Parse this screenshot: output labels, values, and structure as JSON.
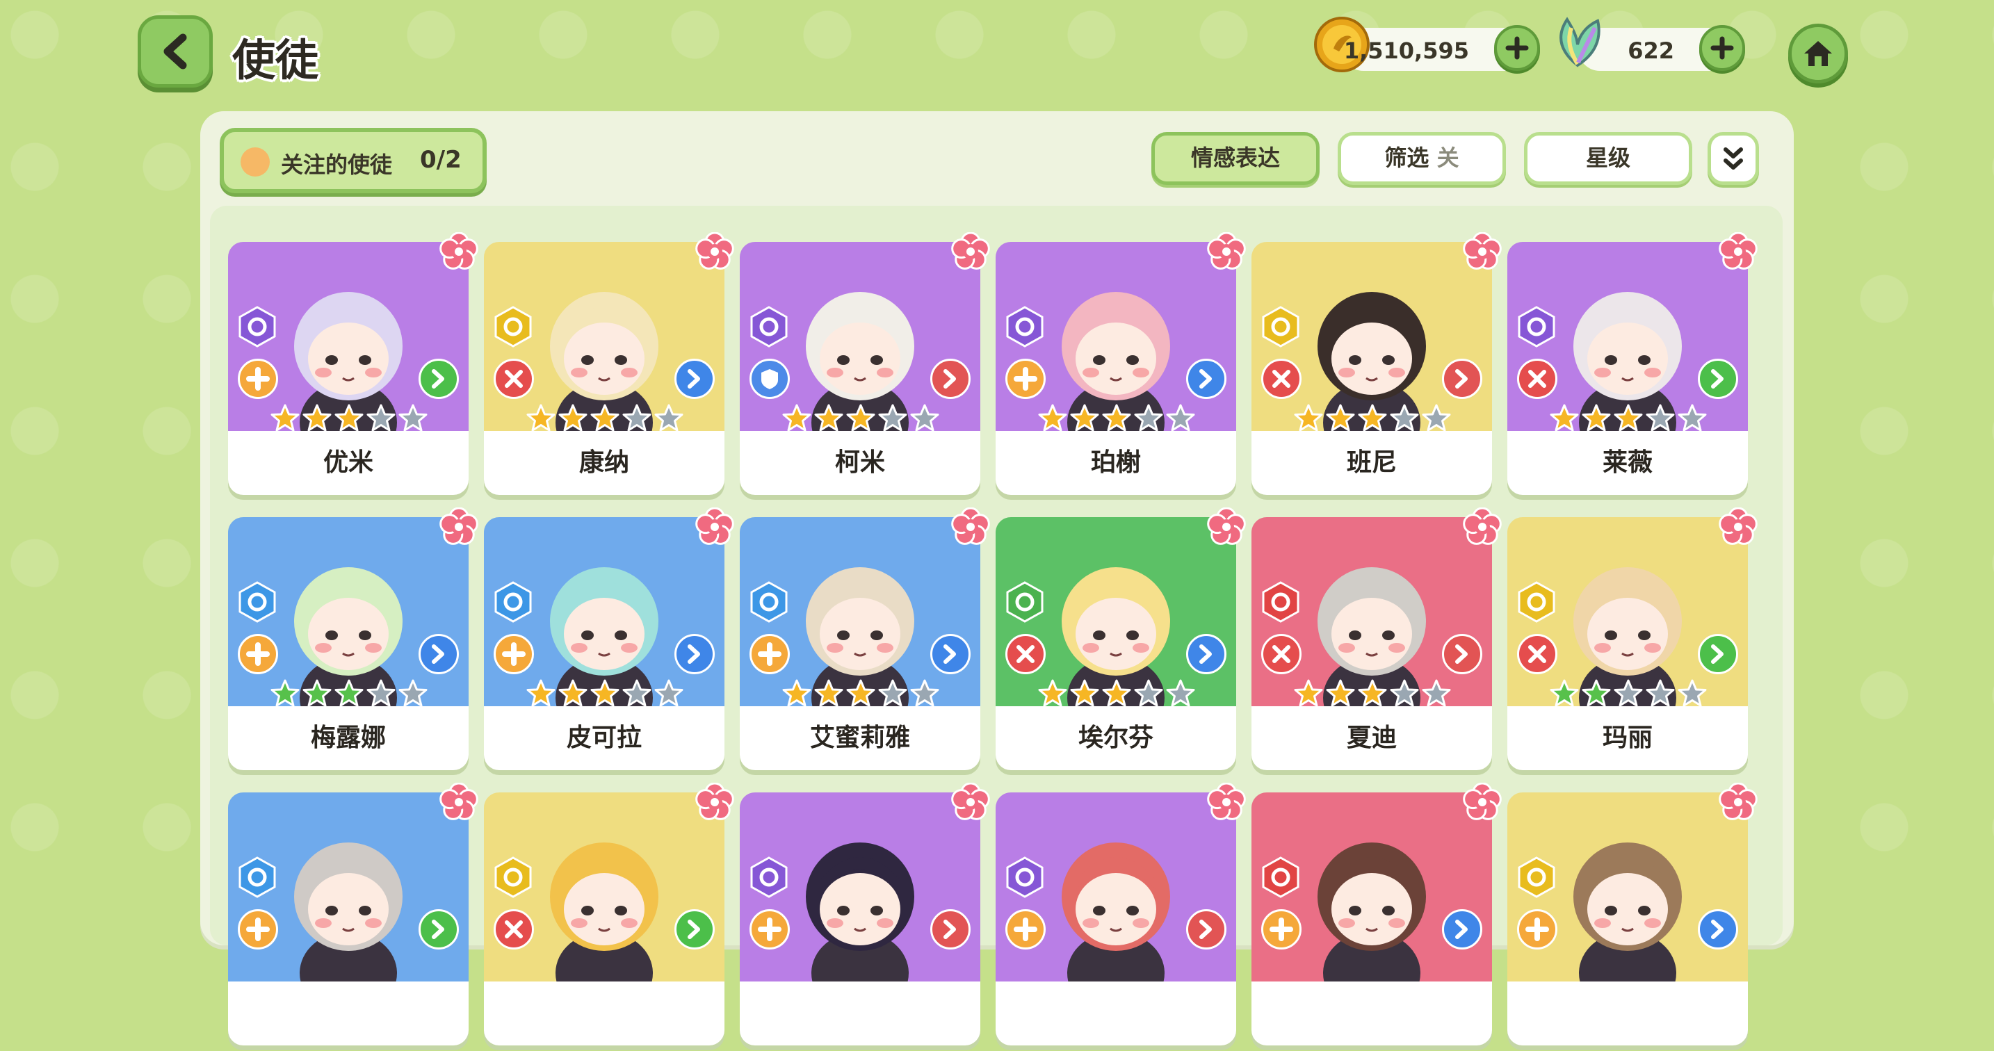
{
  "header": {
    "title": "使徒",
    "coins": "1,510,595",
    "gems": "622"
  },
  "toolbar": {
    "favorite_label": "关注的使徒",
    "favorite_count": "0/2",
    "emotion_label": "情感表达",
    "filter_label": "筛选",
    "filter_state": "关",
    "star_label": "星级"
  },
  "colors": {
    "purple": "#b97ee6",
    "yellow": "#efdd80",
    "blue": "#6faaec",
    "green": "#5cc166",
    "red": "#ea6f86",
    "attack_role": "#e54d4d",
    "support_role": "#f5a83a",
    "defense_role": "#4c8ae8",
    "star_gold": "#f6b624",
    "star_green": "#57c14b",
    "star_empty": "#9aa7b2"
  },
  "characters": [
    {
      "name": "优米",
      "bg": "purple",
      "element": "purple-swirl-icon",
      "role": "support",
      "arrow": "green",
      "stars": 3,
      "star_color": "gold"
    },
    {
      "name": "康纳",
      "bg": "yellow",
      "element": "yellow-sun-icon",
      "role": "attack",
      "arrow": "blue",
      "stars": 3,
      "star_color": "gold"
    },
    {
      "name": "柯米",
      "bg": "purple",
      "element": "purple-swirl-icon",
      "role": "defense",
      "arrow": "red",
      "stars": 3,
      "star_color": "gold"
    },
    {
      "name": "珀榭",
      "bg": "purple",
      "element": "purple-swirl-icon",
      "role": "support",
      "arrow": "blue",
      "stars": 3,
      "star_color": "gold"
    },
    {
      "name": "班尼",
      "bg": "yellow",
      "element": "yellow-sun-icon",
      "role": "attack",
      "arrow": "red",
      "stars": 3,
      "star_color": "gold"
    },
    {
      "name": "莱薇",
      "bg": "purple",
      "element": "purple-swirl-icon",
      "role": "attack",
      "arrow": "green",
      "stars": 3,
      "star_color": "gold"
    },
    {
      "name": "梅露娜",
      "bg": "blue",
      "element": "blue-snowflake-icon",
      "role": "support",
      "arrow": "blue",
      "stars": 3,
      "star_color": "green"
    },
    {
      "name": "皮可拉",
      "bg": "blue",
      "element": "blue-snowflake-icon",
      "role": "support",
      "arrow": "blue",
      "stars": 3,
      "star_color": "gold"
    },
    {
      "name": "艾蜜莉雅",
      "bg": "blue",
      "element": "blue-snowflake-icon",
      "role": "support",
      "arrow": "blue",
      "stars": 3,
      "star_color": "gold"
    },
    {
      "name": "埃尔芬",
      "bg": "green",
      "element": "green-clover-icon",
      "role": "attack",
      "arrow": "blue",
      "stars": 3,
      "star_color": "gold"
    },
    {
      "name": "夏迪",
      "bg": "red",
      "element": "red-flame-icon",
      "role": "attack",
      "arrow": "red",
      "stars": 3,
      "star_color": "gold"
    },
    {
      "name": "玛丽",
      "bg": "yellow",
      "element": "yellow-sun-icon",
      "role": "attack",
      "arrow": "green",
      "stars": 2,
      "star_color": "green"
    },
    {
      "name": "",
      "bg": "blue",
      "element": "blue-snowflake-icon",
      "role": "support",
      "arrow": "green",
      "stars": 0,
      "star_color": "gold"
    },
    {
      "name": "",
      "bg": "yellow",
      "element": "yellow-sun-icon",
      "role": "attack",
      "arrow": "green",
      "stars": 0,
      "star_color": "gold"
    },
    {
      "name": "",
      "bg": "purple",
      "element": "purple-swirl-icon",
      "role": "support",
      "arrow": "red",
      "stars": 0,
      "star_color": "gold"
    },
    {
      "name": "",
      "bg": "purple",
      "element": "purple-swirl-icon",
      "role": "support",
      "arrow": "red",
      "stars": 0,
      "star_color": "gold"
    },
    {
      "name": "",
      "bg": "red",
      "element": "red-flame-icon",
      "role": "support",
      "arrow": "blue",
      "stars": 0,
      "star_color": "gold"
    },
    {
      "name": "",
      "bg": "yellow",
      "element": "yellow-sun-icon",
      "role": "support",
      "arrow": "blue",
      "stars": 0,
      "star_color": "gold"
    }
  ]
}
